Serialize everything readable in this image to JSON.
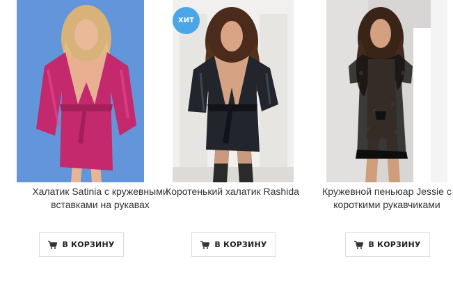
{
  "products": [
    {
      "title": "Халатик Satinia с кружевными вставками на рукавах",
      "button_label": "В КОРЗИНУ",
      "photo": "woman-in-pink-satin-robe"
    },
    {
      "title": "Коротенький халатик Rashida",
      "button_label": "В КОРЗИНУ",
      "badge": "ХИТ",
      "photo": "woman-in-black-satin-robe"
    },
    {
      "title": "Кружевной пеньюар Jessie с короткими рукавчиками",
      "button_label": "В КОРЗИНУ",
      "photo": "woman-in-black-lace-peignoir"
    }
  ],
  "icons": {
    "cart": "cart-icon"
  },
  "colors": {
    "badge": "#4aa6e6",
    "button_border": "#dcdcdc",
    "title_text": "#333333"
  }
}
